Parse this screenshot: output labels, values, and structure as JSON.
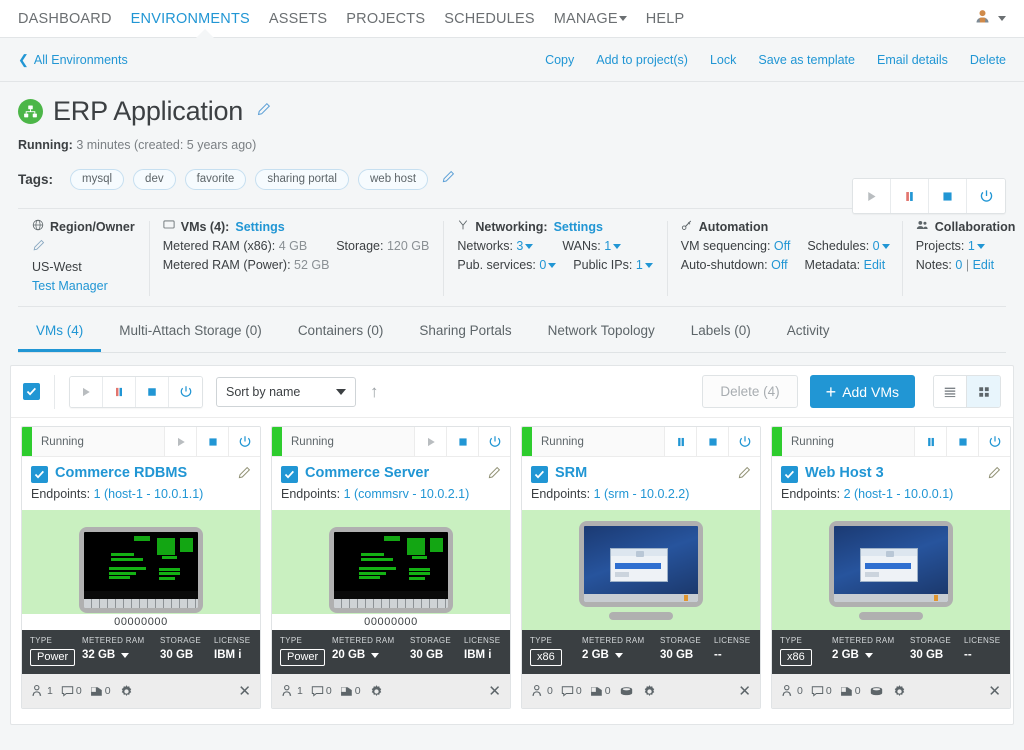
{
  "topnav": {
    "items": [
      {
        "label": "DASHBOARD",
        "active": false,
        "caret": false
      },
      {
        "label": "ENVIRONMENTS",
        "active": true,
        "caret": false
      },
      {
        "label": "ASSETS",
        "active": false,
        "caret": false
      },
      {
        "label": "PROJECTS",
        "active": false,
        "caret": false
      },
      {
        "label": "SCHEDULES",
        "active": false,
        "caret": false
      },
      {
        "label": "MANAGE",
        "active": false,
        "caret": true
      },
      {
        "label": "HELP",
        "active": false,
        "caret": false
      }
    ],
    "user_icon": "user-avatar-icon",
    "user_caret": "chevron-down-icon"
  },
  "breadcrumb": {
    "back_label": "All Environments",
    "actions": [
      "Copy",
      "Add to project(s)",
      "Lock",
      "Save as template",
      "Email details",
      "Delete"
    ]
  },
  "header": {
    "title": "ERP Application",
    "edit_icon": "pencil-icon",
    "status_label": "Running:",
    "status_value": "3 minutes (created: 5 years ago)",
    "tags_label": "Tags:",
    "tags": [
      "mysql",
      "dev",
      "favorite",
      "sharing portal",
      "web host"
    ],
    "controls": [
      "play-icon",
      "pause-icon",
      "stop-icon",
      "power-icon"
    ]
  },
  "info": {
    "region": {
      "title": "Region/Owner",
      "icon": "globe-icon",
      "edit_icon": "pencil-icon",
      "region": "US-West",
      "owner": "Test Manager"
    },
    "vms": {
      "title": "VMs (4):",
      "icon": "monitor-icon",
      "settings_link": "Settings",
      "ram_x86_label": "Metered RAM (x86):",
      "ram_x86_value": "4 GB",
      "storage_label": "Storage:",
      "storage_value": "120 GB",
      "ram_power_label": "Metered RAM (Power):",
      "ram_power_value": "52 GB"
    },
    "networking": {
      "title": "Networking:",
      "icon": "network-icon",
      "settings_link": "Settings",
      "networks_label": "Networks:",
      "networks_value": "3",
      "wans_label": "WANs:",
      "wans_value": "1",
      "pub_services_label": "Pub. services:",
      "pub_services_value": "0",
      "public_ips_label": "Public IPs:",
      "public_ips_value": "1"
    },
    "automation": {
      "title": "Automation",
      "icon": "automation-icon",
      "vm_sequencing_label": "VM sequencing:",
      "vm_sequencing_value": "Off",
      "schedules_label": "Schedules:",
      "schedules_value": "0",
      "auto_shutdown_label": "Auto-shutdown:",
      "auto_shutdown_value": "Off",
      "metadata_label": "Metadata:",
      "metadata_value": "Edit"
    },
    "collaboration": {
      "title": "Collaboration",
      "icon": "people-icon",
      "projects_label": "Projects:",
      "projects_value": "1",
      "notes_label": "Notes:",
      "notes_value": "0",
      "notes_sep": "|",
      "notes_edit": "Edit"
    }
  },
  "tabs": [
    {
      "label": "VMs (4)",
      "active": true
    },
    {
      "label": "Multi-Attach Storage (0)",
      "active": false
    },
    {
      "label": "Containers (0)",
      "active": false
    },
    {
      "label": "Sharing Portals",
      "active": false
    },
    {
      "label": "Network Topology",
      "active": false
    },
    {
      "label": "Labels (0)",
      "active": false
    },
    {
      "label": "Activity",
      "active": false
    }
  ],
  "toolbar": {
    "select_all_checked": true,
    "controls": [
      "play-icon",
      "pause-icon",
      "stop-icon",
      "power-icon"
    ],
    "sort_value": "Sort by name",
    "sort_options": [
      "Sort by name"
    ],
    "sort_direction_icon": "arrow-up-icon",
    "delete_label": "Delete (4)",
    "add_label": "Add VMs",
    "add_plus": "+",
    "view_list_icon": "list-view-icon",
    "view_grid_icon": "grid-view-icon",
    "view_active": "grid"
  },
  "cards": [
    {
      "status": "Running",
      "status_color": "#2ecc2e",
      "controls": [
        "play-icon",
        "stop-icon",
        "power-icon"
      ],
      "first_control": "play",
      "checked": true,
      "name": "Commerce RDBMS",
      "endpoints_label": "Endpoints:",
      "endpoints_value": "1 (host-1 - 10.0.1.1)",
      "thumb_type": "terminal",
      "thumb_caption": "00000000",
      "specs": {
        "type_label": "TYPE",
        "type_value": "Power",
        "ram_label": "METERED RAM",
        "ram_value": "32 GB",
        "storage_label": "STORAGE",
        "storage_value": "30 GB",
        "license_label": "LICENSE",
        "license_value": "IBM i"
      },
      "footer": {
        "users_icon": "users-icon",
        "users_count": "1",
        "comments_icon": "comment-icon",
        "comments_count": "0",
        "notes_icon": "note-icon",
        "notes_count": "0",
        "has_disk": false,
        "disk_icon": "disk-icon",
        "gear_icon": "gear-icon",
        "close_icon": "close-icon"
      }
    },
    {
      "status": "Running",
      "status_color": "#2ecc2e",
      "controls": [
        "play-icon",
        "stop-icon",
        "power-icon"
      ],
      "first_control": "play",
      "checked": true,
      "name": "Commerce Server",
      "endpoints_label": "Endpoints:",
      "endpoints_value": "1 (commsrv - 10.0.2.1)",
      "thumb_type": "terminal",
      "thumb_caption": "00000000",
      "specs": {
        "type_label": "TYPE",
        "type_value": "Power",
        "ram_label": "METERED RAM",
        "ram_value": "20 GB",
        "storage_label": "STORAGE",
        "storage_value": "30 GB",
        "license_label": "LICENSE",
        "license_value": "IBM i"
      },
      "footer": {
        "users_icon": "users-icon",
        "users_count": "1",
        "comments_icon": "comment-icon",
        "comments_count": "0",
        "notes_icon": "note-icon",
        "notes_count": "0",
        "has_disk": false,
        "disk_icon": "disk-icon",
        "gear_icon": "gear-icon",
        "close_icon": "close-icon"
      }
    },
    {
      "status": "Running",
      "status_color": "#2ecc2e",
      "controls": [
        "pause-icon",
        "stop-icon",
        "power-icon"
      ],
      "first_control": "pause",
      "checked": true,
      "name": "SRM",
      "endpoints_label": "Endpoints:",
      "endpoints_value": "1 (srm - 10.0.2.2)",
      "thumb_type": "windows",
      "thumb_caption": "",
      "specs": {
        "type_label": "TYPE",
        "type_value": "x86",
        "ram_label": "METERED RAM",
        "ram_value": "2 GB",
        "storage_label": "STORAGE",
        "storage_value": "30 GB",
        "license_label": "LICENSE",
        "license_value": "--"
      },
      "footer": {
        "users_icon": "users-icon",
        "users_count": "0",
        "comments_icon": "comment-icon",
        "comments_count": "0",
        "notes_icon": "note-icon",
        "notes_count": "0",
        "has_disk": true,
        "disk_icon": "disk-icon",
        "gear_icon": "gear-icon",
        "close_icon": "close-icon"
      }
    },
    {
      "status": "Running",
      "status_color": "#2ecc2e",
      "controls": [
        "pause-icon",
        "stop-icon",
        "power-icon"
      ],
      "first_control": "pause",
      "checked": true,
      "name": "Web Host 3",
      "endpoints_label": "Endpoints:",
      "endpoints_value": "2 (host-1 - 10.0.0.1)",
      "thumb_type": "windows",
      "thumb_caption": "",
      "specs": {
        "type_label": "TYPE",
        "type_value": "x86",
        "ram_label": "METERED RAM",
        "ram_value": "2 GB",
        "storage_label": "STORAGE",
        "storage_value": "30 GB",
        "license_label": "LICENSE",
        "license_value": "--"
      },
      "footer": {
        "users_icon": "users-icon",
        "users_count": "0",
        "comments_icon": "comment-icon",
        "comments_count": "0",
        "notes_icon": "note-icon",
        "notes_count": "0",
        "has_disk": true,
        "disk_icon": "disk-icon",
        "gear_icon": "gear-icon",
        "close_icon": "close-icon"
      }
    }
  ],
  "colors": {
    "accent": "#2196d4",
    "green": "#4cb648",
    "status_green": "#2ecc2e",
    "dark_bar": "#3a3f42",
    "page_bg": "#f4f6f7"
  }
}
